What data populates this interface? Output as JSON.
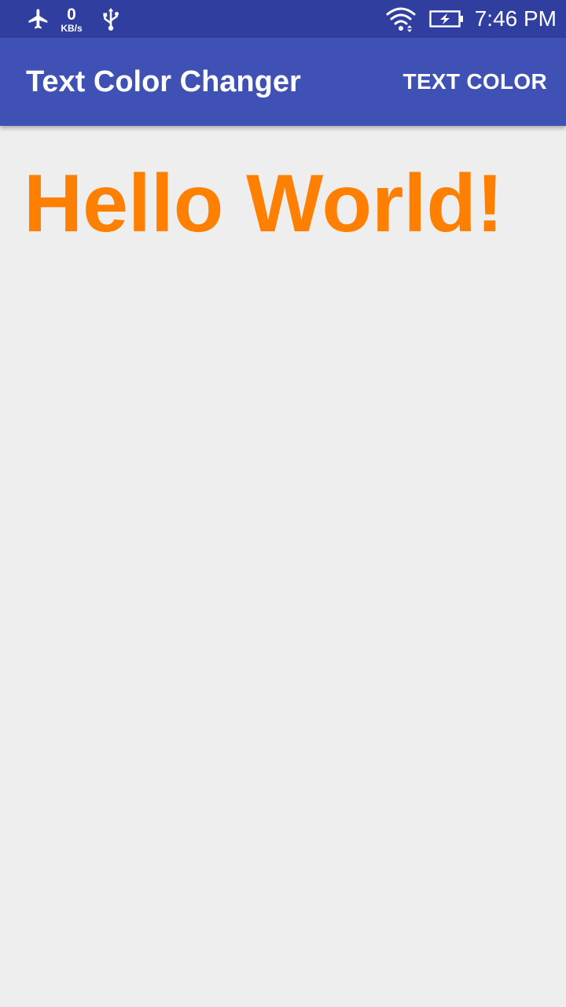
{
  "status_bar": {
    "speed_value": "0",
    "speed_unit": "KB/s",
    "time": "7:46 PM",
    "icons": [
      "airplane-icon",
      "usb-icon",
      "wifi-icon",
      "battery-charging-icon"
    ]
  },
  "app_bar": {
    "title": "Text Color Changer",
    "action_label": "TEXT COLOR"
  },
  "main": {
    "message": "Hello World!",
    "message_color": "#ff7f00"
  },
  "colors": {
    "status_bar": "#303f9f",
    "primary": "#3f51b5",
    "background": "#eeeeee",
    "on_primary": "#ffffff"
  }
}
